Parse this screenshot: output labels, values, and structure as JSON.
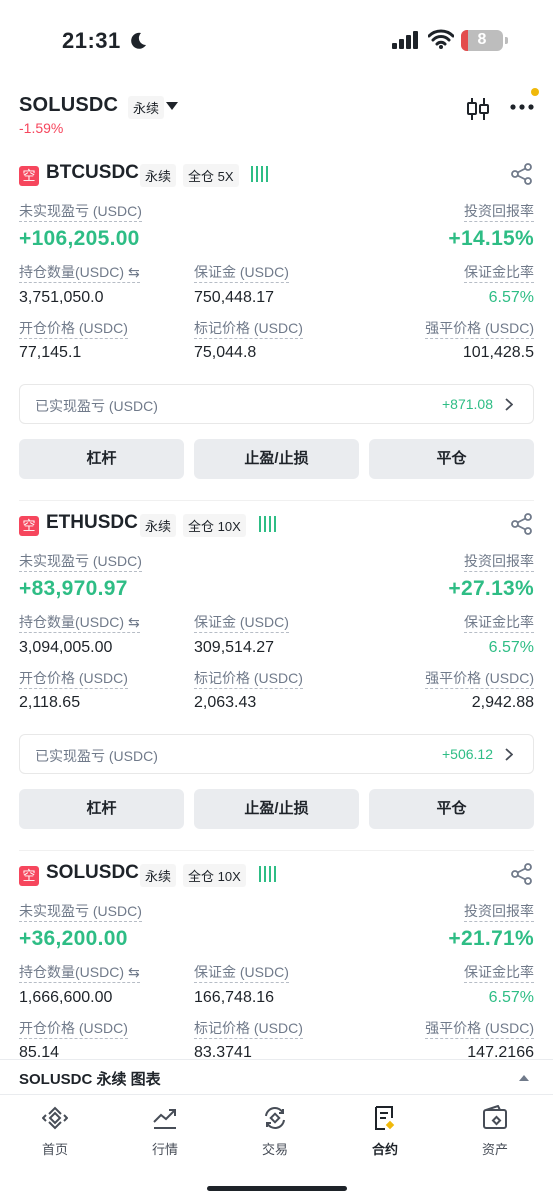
{
  "status": {
    "time": "21:31",
    "battery": "8"
  },
  "header": {
    "symbol": "SOLUSDC",
    "tag": "永续",
    "change": "-1.59%"
  },
  "positions": [
    {
      "badge": "空",
      "symbol": "BTCUSDC",
      "tag_perp": "永续",
      "tag_margin": "全仓 5X",
      "unrealized_label": "未实现盈亏 (USDC)",
      "unrealized": "+106,205.00",
      "roi_label": "投资回报率",
      "roi": "+14.15%",
      "size_label": "持仓数量(USDC)",
      "size": "3,751,050.0",
      "margin_label": "保证金 (USDC)",
      "margin": "750,448.17",
      "margin_ratio_label": "保证金比率",
      "margin_ratio": "6.57%",
      "entry_label": "开仓价格 (USDC)",
      "entry": "77,145.1",
      "mark_label": "标记价格 (USDC)",
      "mark": "75,044.8",
      "liq_label": "强平价格 (USDC)",
      "liq": "101,428.5",
      "realized_label": "已实现盈亏 (USDC)",
      "realized": "+871.08",
      "btn_leverage": "杠杆",
      "btn_tpsl": "止盈/止损",
      "btn_close": "平仓"
    },
    {
      "badge": "空",
      "symbol": "ETHUSDC",
      "tag_perp": "永续",
      "tag_margin": "全仓 10X",
      "unrealized_label": "未实现盈亏 (USDC)",
      "unrealized": "+83,970.97",
      "roi_label": "投资回报率",
      "roi": "+27.13%",
      "size_label": "持仓数量(USDC)",
      "size": "3,094,005.00",
      "margin_label": "保证金 (USDC)",
      "margin": "309,514.27",
      "margin_ratio_label": "保证金比率",
      "margin_ratio": "6.57%",
      "entry_label": "开仓价格 (USDC)",
      "entry": "2,118.65",
      "mark_label": "标记价格 (USDC)",
      "mark": "2,063.43",
      "liq_label": "强平价格 (USDC)",
      "liq": "2,942.88",
      "realized_label": "已实现盈亏 (USDC)",
      "realized": "+506.12",
      "btn_leverage": "杠杆",
      "btn_tpsl": "止盈/止损",
      "btn_close": "平仓"
    },
    {
      "badge": "空",
      "symbol": "SOLUSDC",
      "tag_perp": "永续",
      "tag_margin": "全仓 10X",
      "unrealized_label": "未实现盈亏 (USDC)",
      "unrealized": "+36,200.00",
      "roi_label": "投资回报率",
      "roi": "+21.71%",
      "size_label": "持仓数量(USDC)",
      "size": "1,666,600.00",
      "margin_label": "保证金 (USDC)",
      "margin": "166,748.16",
      "margin_ratio_label": "保证金比率",
      "margin_ratio": "6.57%",
      "entry_label": "开仓价格 (USDC)",
      "entry": "85.14",
      "mark_label": "标记价格 (USDC)",
      "mark": "83.3741",
      "liq_label": "强平价格 (USDC)",
      "liq": "147.2166"
    }
  ],
  "chart_bar": {
    "label": "SOLUSDC 永续 图表"
  },
  "tabs": [
    {
      "label": "首页",
      "icon": "binance-logo-icon"
    },
    {
      "label": "行情",
      "icon": "market-chart-icon"
    },
    {
      "label": "交易",
      "icon": "trade-exchange-icon"
    },
    {
      "label": "合约",
      "icon": "futures-icon"
    },
    {
      "label": "资产",
      "icon": "wallet-icon"
    }
  ],
  "colors": {
    "green": "#2ebd85",
    "red": "#f6465d",
    "yellow": "#f0b90b"
  }
}
